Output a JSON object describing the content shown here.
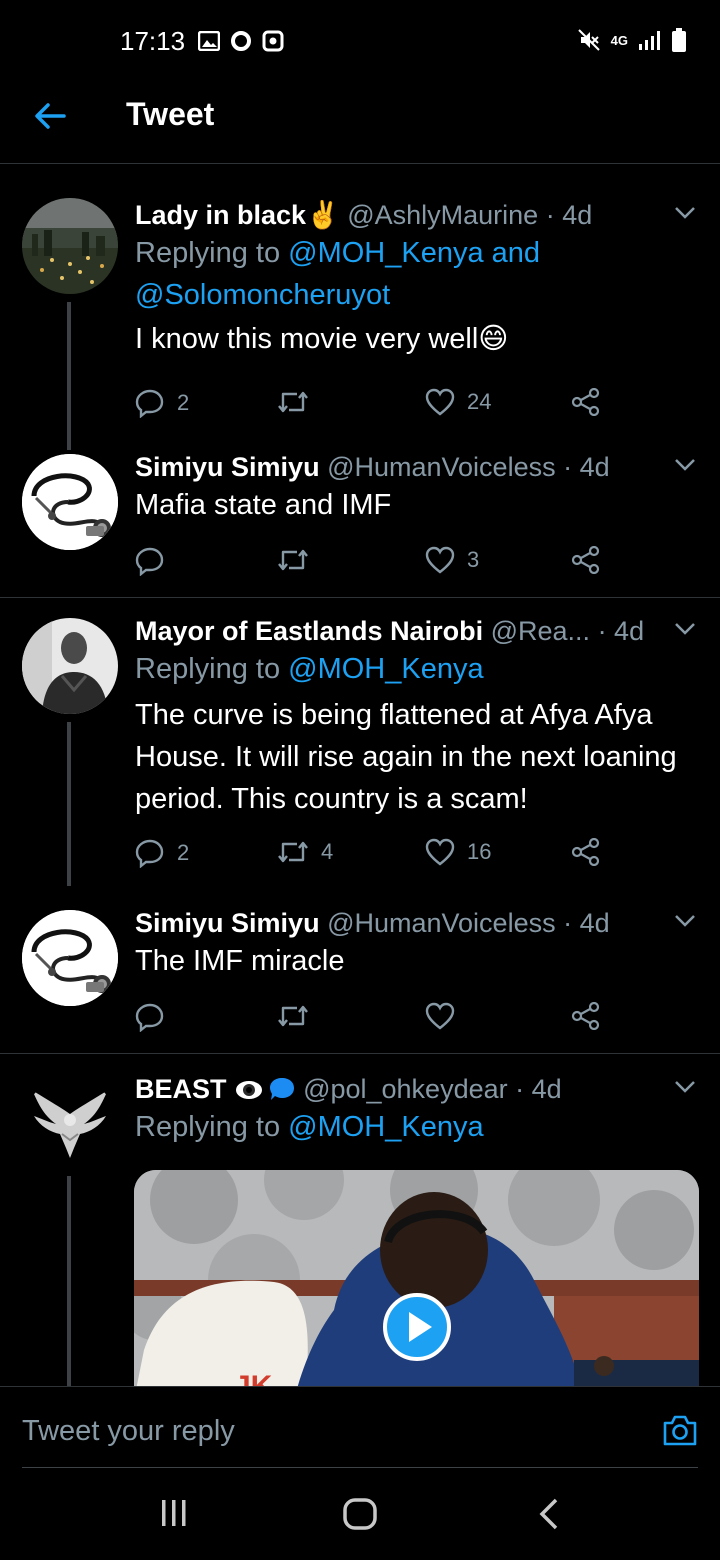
{
  "status_bar": {
    "time": "17:13",
    "network": "4G",
    "icons": [
      "gallery-icon",
      "circle-o-icon",
      "square-o-icon",
      "mute-icon",
      "signal-icon",
      "battery-icon"
    ]
  },
  "header": {
    "title": "Tweet",
    "back_icon": "arrow-left-icon"
  },
  "tweets": [
    {
      "name": "Lady in black✌️",
      "handle": "@AshlyMaurine",
      "time": "· 4d",
      "replying_prefix": "Replying to ",
      "replying_to": "@MOH_Kenya and",
      "replying_to_2": "@Solomoncheruyot",
      "text": "I know this movie very well😄",
      "replies": "2",
      "retweets": "",
      "likes": "24"
    },
    {
      "name": "Simiyu Simiyu",
      "handle": "@HumanVoiceless",
      "time": "· 4d",
      "text": "Mafia state and IMF",
      "replies": "",
      "retweets": "",
      "likes": "3"
    },
    {
      "name": "Mayor of Eastlands Nairobi",
      "handle": "@Rea...",
      "time": "· 4d",
      "replying_prefix": "Replying to ",
      "replying_to": "@MOH_Kenya",
      "text_lines": [
        "The curve is being flattened at Afya Afya",
        "House. It will rise again in the next loaning",
        "period. This country is a scam!"
      ],
      "replies": "2",
      "retweets": "4",
      "likes": "16"
    },
    {
      "name": "Simiyu Simiyu",
      "handle": "@HumanVoiceless",
      "time": "· 4d",
      "text": "The IMF miracle",
      "replies": "",
      "retweets": "",
      "likes": ""
    },
    {
      "name": "BEAST",
      "handle": "@pol_ohkeydear",
      "time": "· 4d",
      "replying_prefix": "Replying to ",
      "replying_to": "@MOH_Kenya",
      "media_caption": "JK"
    }
  ],
  "composer": {
    "placeholder": "Tweet your reply",
    "camera_icon": "camera-icon"
  },
  "nav_bar": {
    "icons": [
      "recents-icon",
      "home-icon",
      "back-icon"
    ]
  },
  "colors": {
    "accent": "#1da1f2",
    "secondary_text": "#8899a6",
    "divider": "#2f3336",
    "background": "#000000"
  }
}
